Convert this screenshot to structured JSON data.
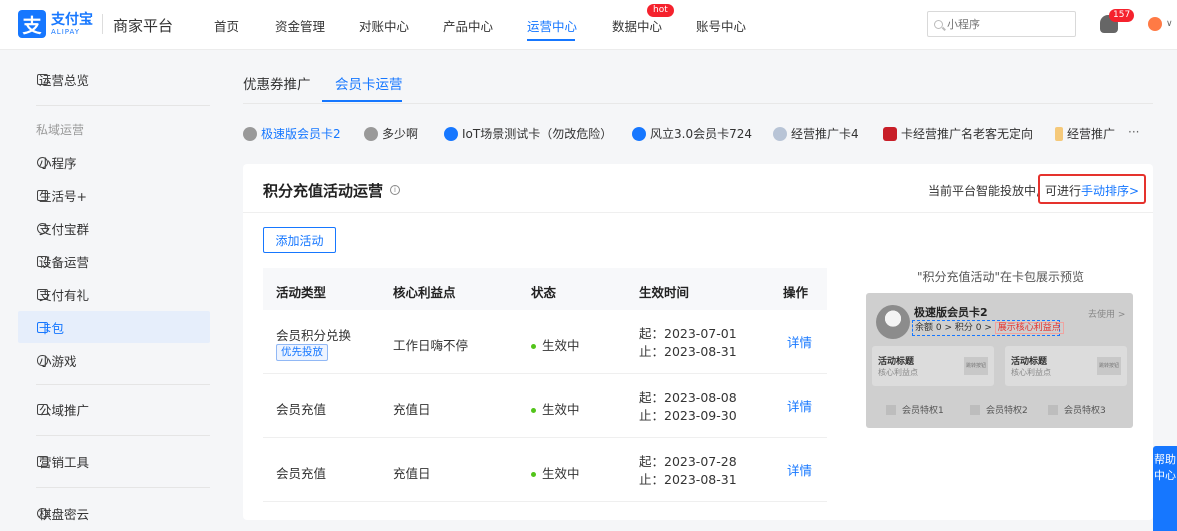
{
  "header": {
    "logo_cn": "支付宝",
    "logo_en": "ALIPAY",
    "brand": "商家平台",
    "nav": [
      "首页",
      "资金管理",
      "对账中心",
      "产品中心",
      "运营中心",
      "数据中心",
      "账号中心"
    ],
    "hot_label": "hot",
    "search_placeholder": "小程序",
    "notification_count": "157"
  },
  "sidebar": {
    "overview": "运营总览",
    "private_group": "私域运营",
    "items": [
      "小程序",
      "生活号+",
      "支付宝群",
      "设备运营",
      "支付有礼",
      "卡包",
      "小游戏"
    ],
    "public": "公域推广",
    "marketing": "营销工具",
    "chess": "棋盘密云"
  },
  "tabs": [
    "优惠券推广",
    "会员卡运营"
  ],
  "chips": [
    "极速版会员卡2",
    "多少啊",
    "IoT场景测试卡（勿改危险）",
    "风立3.0会员卡724",
    "经营推广卡4",
    "卡经营推广名老客无定向",
    "经营推广"
  ],
  "chips_more": "···",
  "card": {
    "title": "积分充值活动运营",
    "note_prefix": "当前平台智能投放中,",
    "note_hl_prefix": "可进行",
    "note_link": "手动排序>",
    "add_button": "添加活动"
  },
  "table": {
    "headers": [
      "活动类型",
      "核心利益点",
      "状态",
      "生效时间",
      "操作"
    ],
    "rows": [
      {
        "type": "会员积分兑换",
        "tag": "优先投放",
        "benefit": "工作日嗨不停",
        "status": "生效中",
        "start": "起：2023-07-01",
        "end": "止：2023-08-31",
        "op": "详情"
      },
      {
        "type": "会员充值",
        "tag": "",
        "benefit": "充值日",
        "status": "生效中",
        "start": "起：2023-08-08",
        "end": "止：2023-09-30",
        "op": "详情"
      },
      {
        "type": "会员充值",
        "tag": "",
        "benefit": "充值日",
        "status": "生效中",
        "start": "起：2023-07-28",
        "end": "止：2023-08-31",
        "op": "详情"
      }
    ]
  },
  "preview": {
    "title": "\"积分充值活动\"在卡包展示预览",
    "card_name": "极速版会员卡2",
    "use_link": "去使用 >",
    "balance": "余额 0 >",
    "points": "积分 0 >",
    "show_benefit": "展示核心利益点",
    "box_title": "活动标题",
    "box_sub": "核心利益点",
    "box_btn": "跳转按钮",
    "privileges": [
      "会员特权1",
      "会员特权2",
      "会员特权3"
    ]
  },
  "help": "帮助中心",
  "colors": {
    "primary": "#1677ff",
    "highlight": "#e5322d",
    "status": "#52c41a"
  }
}
